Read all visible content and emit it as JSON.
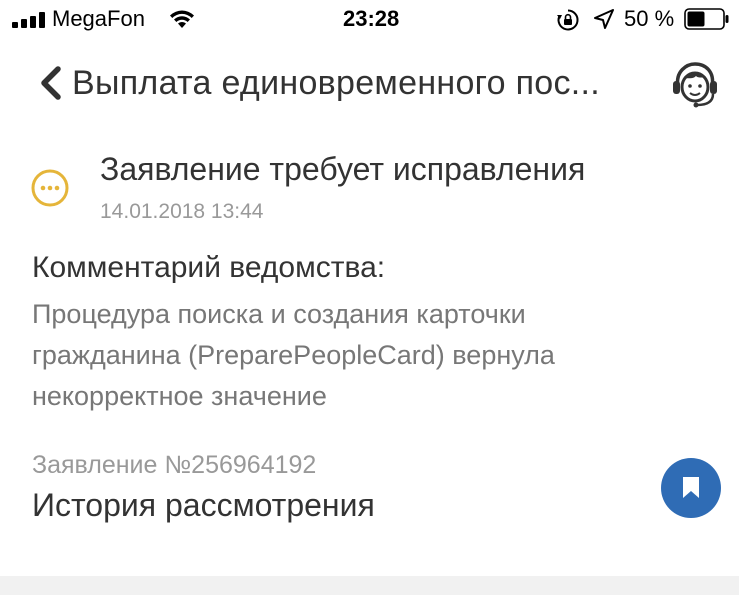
{
  "status_bar": {
    "carrier": "MegaFon",
    "time": "23:28",
    "battery_percent": "50 %",
    "battery_level": 0.5,
    "icons": [
      "signal-icon",
      "wifi-icon",
      "rotation-lock-icon",
      "location-arrow-icon",
      "battery-icon"
    ]
  },
  "nav": {
    "back_icon": "chevron-left-icon",
    "title": "Выплата единовременного пос...",
    "support_icon": "operator-headset-icon"
  },
  "application": {
    "status_icon": "ellipsis-circle-icon",
    "status_title": "Заявление требует исправления",
    "status_date": "14.01.2018 13:44",
    "comment_heading": "Комментарий ведомства:",
    "comment_lines": [
      "Процедура поиска и создания карточки",
      "гражданина (PreparePeopleCard) вернула",
      "некорректное значение"
    ],
    "number": "Заявление №256964192",
    "history_link": "История рассмотрения",
    "bookmark_icon": "bookmark-icon"
  },
  "colors": {
    "status_icon": "#e5b53a",
    "accent_button": "#2f6cb5",
    "text_primary": "#333333",
    "text_secondary": "#999999",
    "text_comment": "#777777"
  }
}
